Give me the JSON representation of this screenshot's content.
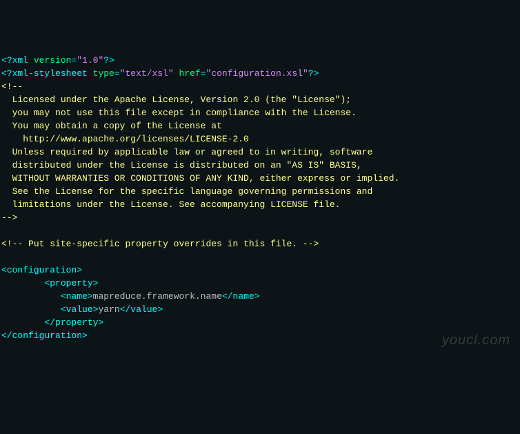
{
  "xml_decl": {
    "open": "<?",
    "name": "xml",
    "attr1_name": "version",
    "attr1_val": "\"1.0\"",
    "close": "?>"
  },
  "stylesheet": {
    "open": "<?",
    "name": "xml-stylesheet",
    "attr1_name": "type",
    "attr1_val": "\"text/xsl\"",
    "attr2_name": "href",
    "attr2_val": "\"configuration.xsl\"",
    "close": "?>"
  },
  "license_comment": {
    "open": "<!--",
    "l1": "  Licensed under the Apache License, Version 2.0 (the \"License\");",
    "l2": "  you may not use this file except in compliance with the License.",
    "l3": "  You may obtain a copy of the License at",
    "l4": "",
    "l5": "    http://www.apache.org/licenses/LICENSE-2.0",
    "l6": "",
    "l7": "  Unless required by applicable law or agreed to in writing, software",
    "l8": "  distributed under the License is distributed on an \"AS IS\" BASIS,",
    "l9": "  WITHOUT WARRANTIES OR CONDITIONS OF ANY KIND, either express or implied.",
    "l10": "  See the License for the specific language governing permissions and",
    "l11": "  limitations under the License. See accompanying LICENSE file.",
    "close": "-->"
  },
  "site_comment": {
    "open": "<!--",
    "text": " Put site-specific property overrides in this file. ",
    "close": "-->"
  },
  "config": {
    "open_tag_l": "<",
    "open_tag_name": "configuration",
    "open_tag_r": ">",
    "close_tag_l": "</",
    "close_tag_r": ">",
    "property": {
      "indent": "        ",
      "open_l": "<",
      "name": "property",
      "open_r": ">",
      "close_l": "</",
      "close_r": ">",
      "inner_indent": "           ",
      "name_tag": {
        "open_l": "<",
        "tag": "name",
        "open_r": ">",
        "value": "mapreduce.framework.name",
        "close_l": "</",
        "close_r": ">"
      },
      "value_tag": {
        "open_l": "<",
        "tag": "value",
        "open_r": ">",
        "value": "yarn",
        "close_l": "</",
        "close_r": ">"
      }
    }
  },
  "watermark": "youcl.com"
}
